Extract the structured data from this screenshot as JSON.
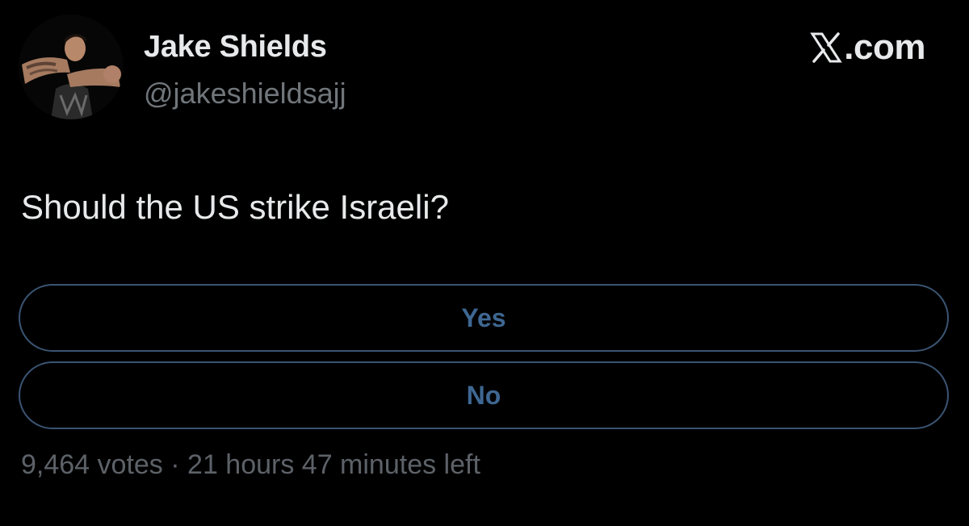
{
  "author": {
    "display_name": "Jake Shields",
    "handle": "@jakeshieldsajj",
    "avatar_icon": "profile-photo"
  },
  "brand": {
    "logo_icon": "x-logo-icon",
    "label": ".com"
  },
  "tweet": {
    "text": "Should the US strike Israeli?"
  },
  "poll": {
    "options": [
      {
        "label": "Yes"
      },
      {
        "label": "No"
      }
    ],
    "votes": "9,464 votes",
    "separator": "·",
    "time_left": "21 hours 47 minutes left"
  },
  "colors": {
    "background": "#000000",
    "primary_text": "#e7e9ea",
    "secondary_text": "#71767b",
    "poll_border": "#3a5472",
    "poll_label": "#3e6792"
  }
}
